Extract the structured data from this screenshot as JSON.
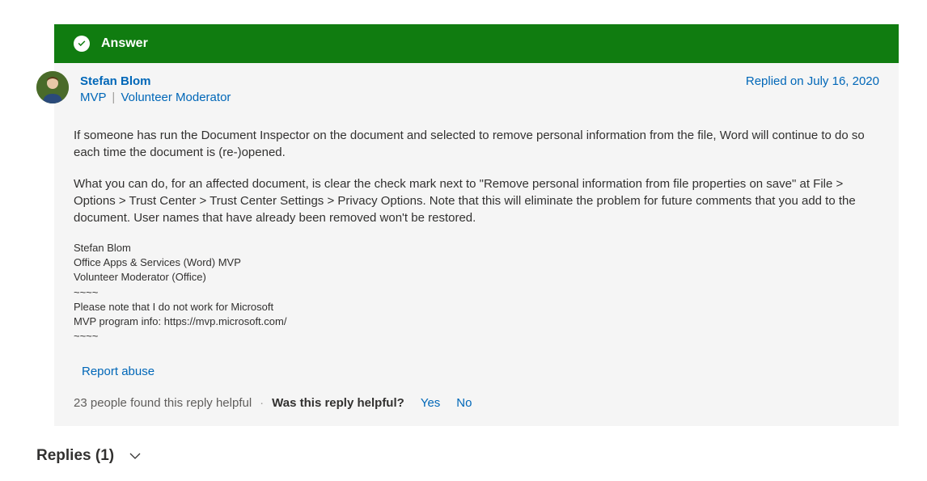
{
  "banner": {
    "label": "Answer"
  },
  "author": {
    "name": "Stefan Blom",
    "title1": "MVP",
    "title2": "Volunteer Moderator"
  },
  "replied": "Replied on July 16, 2020",
  "content": {
    "p1": "If someone has run the Document Inspector on the document and selected to remove personal information from the file, Word will continue to do so each time the document is (re-)opened.",
    "p2": "What you can do, for an affected document, is clear the check mark next to \"Remove personal information from file properties on save\" at File > Options > Trust Center > Trust Center Settings > Privacy Options. Note that this will eliminate the problem for future comments that you add to the document. User names that have already been removed won't be restored."
  },
  "signature": {
    "l1": "Stefan Blom",
    "l2": "Office Apps & Services (Word) MVP",
    "l3": "Volunteer Moderator (Office)",
    "l4": "~~~~",
    "l5": "Please note that I do not work for Microsoft",
    "l6": "MVP program info: https://mvp.microsoft.com/",
    "l7": "~~~~"
  },
  "actions": {
    "report": "Report abuse"
  },
  "helpful": {
    "count_text": "23 people found this reply helpful",
    "question": "Was this reply helpful?",
    "yes": "Yes",
    "no": "No"
  },
  "replies": {
    "label": "Replies (1)"
  }
}
